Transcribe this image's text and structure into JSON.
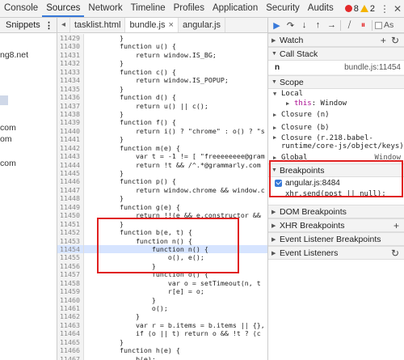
{
  "topbar": {
    "tabs": [
      "Console",
      "Sources",
      "Network",
      "Timeline",
      "Profiles",
      "Application",
      "Security",
      "Audits"
    ],
    "active_tab": "Sources",
    "error_count": "8",
    "warning_count": "2"
  },
  "navigator": {
    "tab_label": "Snippets",
    "items": [
      "ng8.net",
      "com",
      "om",
      "com"
    ]
  },
  "editor": {
    "tabs": [
      {
        "label": "tasklist.html",
        "active": false
      },
      {
        "label": "bundle.js",
        "active": true
      },
      {
        "label": "angular.js",
        "active": false
      }
    ],
    "lines": [
      {
        "n": "11429",
        "t": "        }",
        "hl": false
      },
      {
        "n": "11430",
        "t": "        function u() {",
        "hl": false
      },
      {
        "n": "11431",
        "t": "            return window.IS_BG;",
        "hl": false
      },
      {
        "n": "11432",
        "t": "        }",
        "hl": false
      },
      {
        "n": "11433",
        "t": "        function c() {",
        "hl": false
      },
      {
        "n": "11434",
        "t": "            return window.IS_POPUP;",
        "hl": false
      },
      {
        "n": "11435",
        "t": "        }",
        "hl": false
      },
      {
        "n": "11436",
        "t": "        function d() {",
        "hl": false
      },
      {
        "n": "11437",
        "t": "            return u() || c();",
        "hl": false
      },
      {
        "n": "11438",
        "t": "        }",
        "hl": false
      },
      {
        "n": "11439",
        "t": "        function f() {",
        "hl": false
      },
      {
        "n": "11440",
        "t": "            return i() ? \"chrome\" : o() ? \"s",
        "hl": false
      },
      {
        "n": "11441",
        "t": "        }",
        "hl": false
      },
      {
        "n": "11442",
        "t": "        function m(e) {",
        "hl": false
      },
      {
        "n": "11443",
        "t": "            var t = -1 != [ \"freeeeeeee@gram",
        "hl": false
      },
      {
        "n": "11444",
        "t": "            return !t && /^.*@grammarly.com",
        "hl": false
      },
      {
        "n": "11445",
        "t": "        }",
        "hl": false
      },
      {
        "n": "11446",
        "t": "        function p() {",
        "hl": false
      },
      {
        "n": "11447",
        "t": "            return window.chrome && window.c",
        "hl": false
      },
      {
        "n": "11448",
        "t": "        }",
        "hl": false
      },
      {
        "n": "11449",
        "t": "        function g(e) {",
        "hl": false
      },
      {
        "n": "11450",
        "t": "            return !!(e && e.constructor &&",
        "hl": false
      },
      {
        "n": "11451",
        "t": "        }",
        "hl": false
      },
      {
        "n": "11452",
        "t": "        function b(e, t) {",
        "hl": false
      },
      {
        "n": "11453",
        "t": "            function n() {",
        "hl": false
      },
      {
        "n": "11454",
        "t": "                function n() {",
        "hl": true
      },
      {
        "n": "11455",
        "t": "                    o(), e();",
        "hl": false
      },
      {
        "n": "11456",
        "t": "                }",
        "hl": false
      },
      {
        "n": "11457",
        "t": "                function o() {",
        "hl": false
      },
      {
        "n": "11458",
        "t": "                    var o = setTimeout(n, t",
        "hl": false
      },
      {
        "n": "11459",
        "t": "                    r[e] = o;",
        "hl": false
      },
      {
        "n": "11460",
        "t": "                }",
        "hl": false
      },
      {
        "n": "11461",
        "t": "                o();",
        "hl": false
      },
      {
        "n": "11462",
        "t": "            }",
        "hl": false
      },
      {
        "n": "11463",
        "t": "            var r = b.items = b.items || {},",
        "hl": false
      },
      {
        "n": "11464",
        "t": "            if (o || t) return o && !t ? (c",
        "hl": false
      },
      {
        "n": "11465",
        "t": "        }",
        "hl": false
      },
      {
        "n": "11466",
        "t": "        function h(e) {",
        "hl": false
      },
      {
        "n": "11467",
        "t": "            b(e);",
        "hl": false
      }
    ]
  },
  "debugger": {
    "async_label": "As",
    "watch_label": "Watch",
    "call_stack_label": "Call Stack",
    "call_stack_frame": {
      "fn": "n",
      "loc": "bundle.js:11454"
    },
    "scope_label": "Scope",
    "scope_local": "Local",
    "scope_this_key": "this",
    "scope_this_val": "Window",
    "closures": [
      "Closure (n)",
      "Closure (b)",
      "Closure (r.218.babel-\nruntime/core-js/object/keys)"
    ],
    "global_label": "Global",
    "global_val": "Window",
    "breakpoints_label": "Breakpoints",
    "breakpoint_file": "angular.js:8484",
    "breakpoint_code": "xhr.send(post || null);",
    "dom_bp": "DOM Breakpoints",
    "xhr_bp": "XHR Breakpoints",
    "event_listener_bp": "Event Listener Breakpoints",
    "event_listeners": "Event Listeners"
  },
  "colors": {
    "accent": "#3879d9",
    "annotation_red": "#e02020",
    "highlight_line": "#d6e4ff"
  }
}
